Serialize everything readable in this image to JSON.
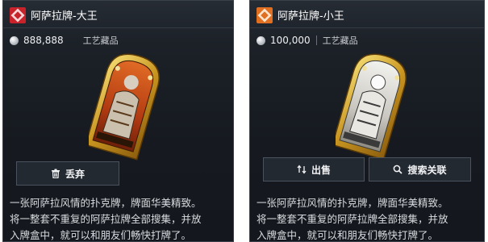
{
  "left_panel": {
    "title": "阿萨拉牌-大王",
    "badge_color": "#d8272f",
    "price": "888,888",
    "category": "工艺藏品",
    "buttons": {
      "discard": "丢弃"
    },
    "description": [
      "一张阿萨拉风情的扑克牌，牌面华美精致。",
      "将一整套不重复的阿萨拉牌全部搜集，并放",
      "入牌盒中，就可以和朋友们畅快打牌了。"
    ]
  },
  "right_panel": {
    "title": "阿萨拉牌-小王",
    "badge_color": "#e5762a",
    "price": "100,000",
    "category": "工艺藏品",
    "buttons": {
      "sell": "出售",
      "search": "搜索关联"
    },
    "description": [
      "一张阿萨拉风情的扑克牌，牌面华美精致。",
      "将一整套不重复的阿萨拉牌全部搜集，并放",
      "入牌盒中，就可以和朋友们畅快打牌了。"
    ]
  },
  "icons": {
    "discard": "trash-icon",
    "sell": "sell-icon",
    "search": "search-icon",
    "currency": "coin-icon"
  }
}
